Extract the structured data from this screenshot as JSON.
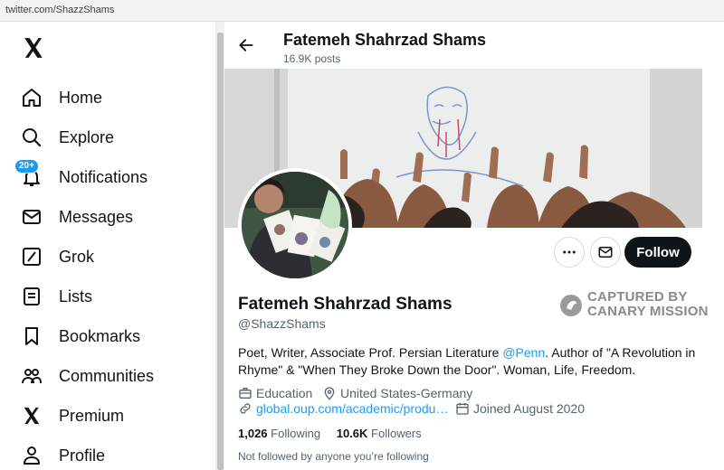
{
  "browser": {
    "url": "twitter.com/ShazzShams"
  },
  "sidebar": {
    "items": [
      {
        "label": "Home",
        "icon": "home-icon"
      },
      {
        "label": "Explore",
        "icon": "search-icon"
      },
      {
        "label": "Notifications",
        "icon": "bell-icon",
        "badge": "20+"
      },
      {
        "label": "Messages",
        "icon": "envelope-icon"
      },
      {
        "label": "Grok",
        "icon": "grok-icon"
      },
      {
        "label": "Lists",
        "icon": "list-icon"
      },
      {
        "label": "Bookmarks",
        "icon": "bookmark-icon"
      },
      {
        "label": "Communities",
        "icon": "people-icon"
      },
      {
        "label": "Premium",
        "icon": "x-logo-icon"
      },
      {
        "label": "Profile",
        "icon": "person-icon"
      }
    ]
  },
  "header": {
    "title": "Fatemeh Shahrzad Shams",
    "posts": "16.9K posts"
  },
  "profile": {
    "name": "Fatemeh Shahrzad Shams",
    "handle": "@ShazzShams",
    "follow_label": "Follow",
    "bio_pre": "Poet, Writer, Associate Prof. Persian Literature ",
    "bio_mention": "@Penn",
    "bio_post": ". Author of \"A Revolution in Rhyme\" & \"When They Broke Down the Door\". Woman, Life, Freedom.",
    "category": "Education",
    "location": "United States-Germany",
    "website": "global.oup.com/academic/produ…",
    "joined": "Joined August 2020",
    "following_count": "1,026",
    "following_label": "Following",
    "followers_count": "10.6K",
    "followers_label": "Followers",
    "followed_note": "Not followed by anyone you’re following"
  },
  "watermark": {
    "line1": "CAPTURED BY",
    "line2": "CANARY MISSION"
  },
  "colors": {
    "accent": "#1d9bf0",
    "text": "#0f1419",
    "muted": "#536471",
    "button": "#0f1419"
  }
}
